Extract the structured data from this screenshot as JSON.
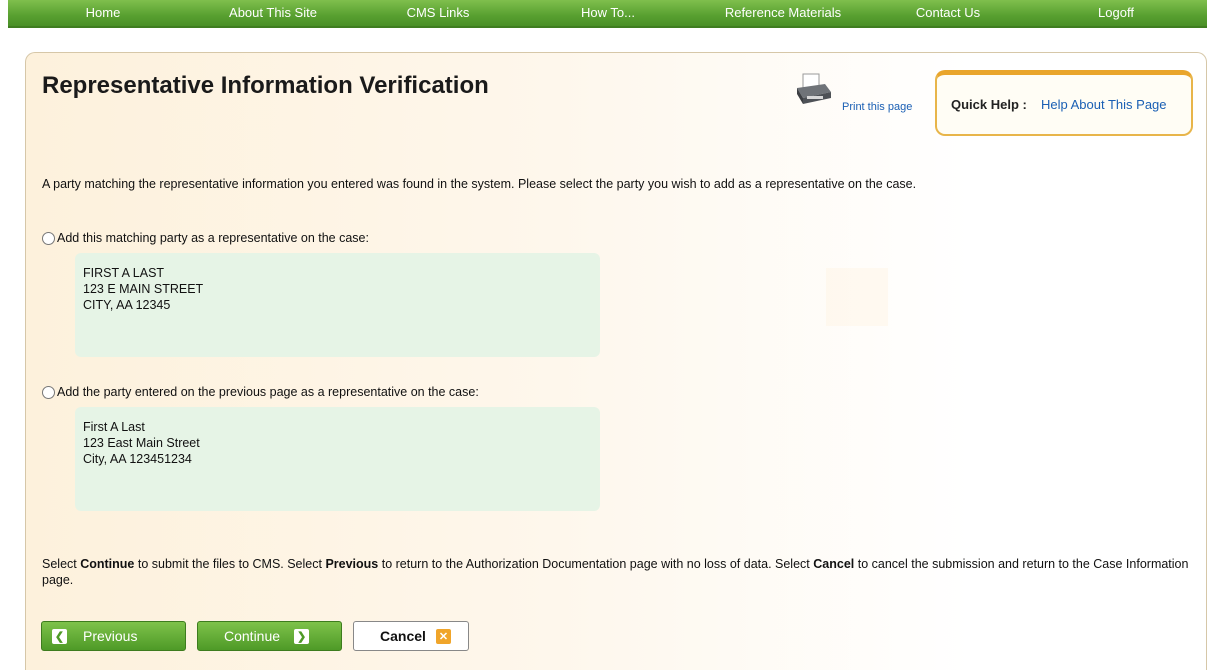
{
  "nav": {
    "items": [
      "Home",
      "About This Site",
      "CMS Links",
      "How To...",
      "Reference Materials",
      "Contact Us",
      "Logoff"
    ]
  },
  "page": {
    "title": "Representative Information Verification",
    "print_label": "Print this page",
    "quick_help_label": "Quick Help :",
    "quick_help_link": "Help About This Page",
    "intro": "A party matching the representative information you entered was found in the system. Please select the party you wish to add as a representative on the case."
  },
  "options": [
    {
      "label": "Add this matching party as a representative on the case:",
      "address": [
        "FIRST A LAST",
        "123 E MAIN STREET",
        "CITY, AA 12345"
      ]
    },
    {
      "label": "Add the party entered on the previous page as a representative on the case:",
      "address": [
        "First A Last",
        "123 East Main Street",
        "City, AA 123451234"
      ]
    }
  ],
  "instructions": {
    "p1": "Select ",
    "continue": "Continue",
    "p2": " to submit the files to CMS. Select ",
    "previous": "Previous",
    "p3": " to return to the Authorization Documentation page with no loss of data. Select ",
    "cancel": "Cancel",
    "p4": " to cancel the submission and return to the Case Information page."
  },
  "buttons": {
    "previous": "Previous",
    "continue": "Continue",
    "cancel": "Cancel"
  },
  "icons": {
    "printer": "printer-icon",
    "prev_arrow": "chevron-left-icon",
    "next_arrow": "chevron-right-icon",
    "cancel_x": "close-icon"
  },
  "colors": {
    "nav_green": "#58a030",
    "link_blue": "#1a5fb4",
    "quick_help_border": "#e9a52b",
    "address_bg": "#e6f4e6",
    "cancel_icon": "#f0a52a"
  }
}
